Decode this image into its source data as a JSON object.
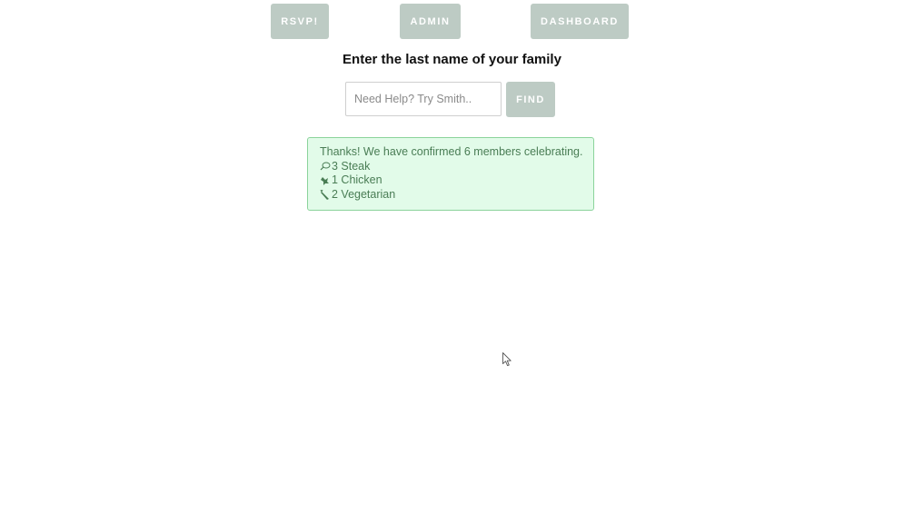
{
  "nav": {
    "rsvp_label": "RSVP!",
    "admin_label": "ADMIN",
    "dashboard_label": "DASHBOARD"
  },
  "heading": "Enter the last name of your family",
  "search": {
    "placeholder": "Need Help? Try Smith..",
    "value": "",
    "button_label": "FIND"
  },
  "confirmation": {
    "message": "Thanks! We have confirmed 6 members celebrating.",
    "meals": [
      {
        "icon": "steak-icon",
        "text": "3 Steak"
      },
      {
        "icon": "chicken-icon",
        "text": "1 Chicken"
      },
      {
        "icon": "vegetarian-icon",
        "text": "2 Vegetarian"
      }
    ]
  },
  "colors": {
    "button_bg": "#bdcbc4",
    "alert_bg": "#e2fbe9",
    "alert_border": "#8bd39b",
    "alert_text": "#4a7d55"
  }
}
